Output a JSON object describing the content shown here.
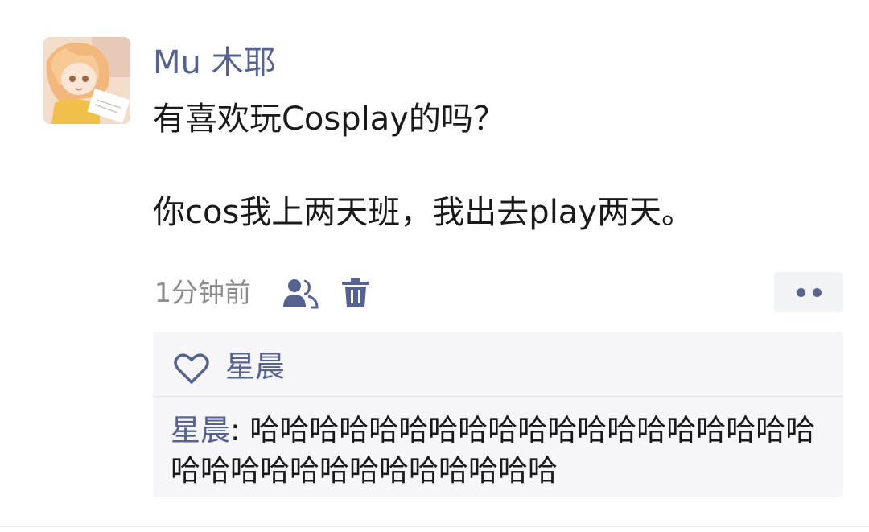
{
  "post": {
    "username": "Mu 木耶",
    "lines": [
      "有喜欢玩Cosplay的吗？",
      "你cos我上两天班，我出去play两天。"
    ],
    "time": "1分钟前",
    "icons": {
      "privacy": "people-icon",
      "delete": "trash-icon",
      "more": "more-dots-icon",
      "like": "heart-icon"
    }
  },
  "likes": {
    "names": "星晨"
  },
  "comments": [
    {
      "author": "星晨",
      "separator": ": ",
      "text": "哈哈哈哈哈哈哈哈哈哈哈哈哈哈哈哈哈哈哈哈哈哈哈哈哈哈哈哈哈哈哈哈"
    }
  ],
  "colors": {
    "accent": "#56628f",
    "text": "#1a1a1a",
    "meta": "#8c8c8c",
    "comment_bg": "#f6f6f8"
  }
}
